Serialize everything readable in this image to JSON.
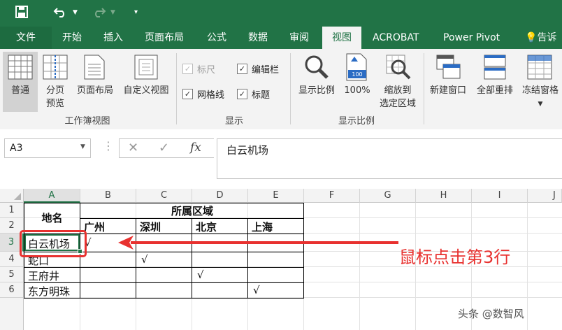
{
  "quick_access": {
    "save_icon": "save-icon",
    "undo_icon": "undo-icon",
    "redo_icon": "redo-icon",
    "customize_icon": "customize-qat-icon"
  },
  "tabs": [
    "文件",
    "开始",
    "插入",
    "页面布局",
    "公式",
    "数据",
    "审阅",
    "视图",
    "ACROBAT",
    "Power Pivot",
    "告诉"
  ],
  "active_tab": "视图",
  "ribbon": {
    "workbook_views": {
      "group_label": "工作簿视图",
      "normal": "普通",
      "page_break_1": "分页",
      "page_break_2": "预览",
      "page_layout": "页面布局",
      "custom_views": "自定义视图"
    },
    "show": {
      "group_label": "显示",
      "ruler": "标尺",
      "formula_bar": "编辑栏",
      "gridlines": "网格线",
      "headings": "标题",
      "ruler_checked": true,
      "formula_bar_checked": true,
      "gridlines_checked": true,
      "headings_checked": true
    },
    "zoom": {
      "group_label": "显示比例",
      "zoom": "显示比例",
      "hundred": "100%",
      "hundred_icon_text": "100",
      "zoom_sel_1": "缩放到",
      "zoom_sel_2": "选定区域"
    },
    "window": {
      "new_window": "新建窗口",
      "arrange_all": "全部重排",
      "freeze_panes": "冻结窗格"
    }
  },
  "formula_bar": {
    "name_box": "A3",
    "fx": "fx",
    "content": "白云机场"
  },
  "columns": [
    "A",
    "B",
    "C",
    "D",
    "E",
    "F",
    "G",
    "H",
    "I",
    "J"
  ],
  "rows": [
    "1",
    "2",
    "3",
    "4",
    "5",
    "6"
  ],
  "table": {
    "place_header": "地名",
    "region_header": "所属区域",
    "regions": [
      "广州",
      "深圳",
      "北京",
      "上海"
    ],
    "places": [
      "白云机场",
      "蛇口",
      "王府井",
      "东方明珠"
    ],
    "check_mark": "√"
  },
  "annotation": {
    "text": "鼠标点击第3行",
    "color": "#e8312f"
  },
  "watermark": "头条 @数智风",
  "colors": {
    "excel_green": "#217346",
    "ribbon_bg": "#f3f3f3"
  }
}
